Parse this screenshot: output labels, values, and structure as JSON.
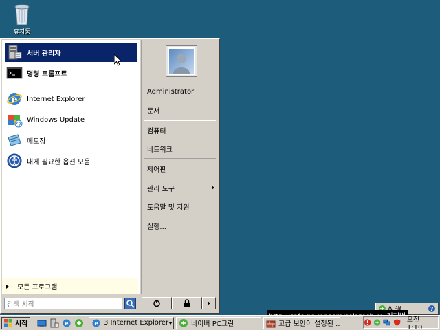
{
  "desktop": {
    "recycle_bin_label": "휴지통"
  },
  "start_menu": {
    "pinned": [
      {
        "label": "서버 관리자",
        "icon": "server-manager-icon"
      },
      {
        "label": "명령 프롬프트",
        "icon": "command-prompt-icon"
      }
    ],
    "recent": [
      {
        "label": "Internet Explorer",
        "icon": "internet-explorer-icon"
      },
      {
        "label": "Windows Update",
        "icon": "windows-update-icon"
      },
      {
        "label": "메모장",
        "icon": "notepad-icon"
      },
      {
        "label": "내게 필요한 옵션 모음",
        "icon": "accessibility-icon"
      }
    ],
    "all_programs_label": "모든 프로그램",
    "search_placeholder": "검색 시작",
    "right": {
      "user": "Administrator",
      "items_group1": [
        "문서"
      ],
      "items_group2": [
        "컴퓨터",
        "네트워크"
      ],
      "items_group3": [
        "제어판",
        "관리 도구",
        "도움말 및 지원",
        "실행..."
      ]
    }
  },
  "language_bar": {
    "mode": "A",
    "lang": "漢"
  },
  "watermark": "http://cafe.naver.com/solatech by 김재범",
  "taskbar": {
    "start_label": "시작",
    "buttons": [
      {
        "label": "3 Internet Explorer",
        "icon": "internet-explorer-icon"
      },
      {
        "label": "네이버 PC그린",
        "icon": "green-plus-icon"
      },
      {
        "label": "고급 보안이 설정된 ...",
        "icon": "security-icon"
      }
    ],
    "clock": "오전 1:10"
  },
  "colors": {
    "desktop": "#1d5c7a",
    "selection": "#0a246a",
    "menu_face": "#d4d0c8"
  }
}
